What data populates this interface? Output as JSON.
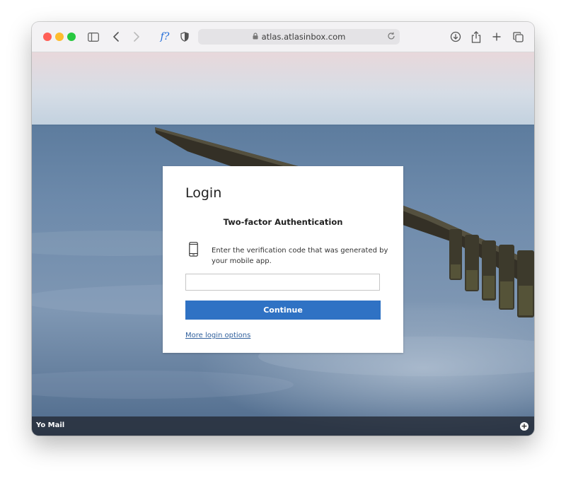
{
  "browser": {
    "address": "atlas.atlasinbox.com",
    "icons": {
      "close": "close-dot",
      "minimize": "minimize-dot",
      "zoom": "zoom-dot",
      "sidebar": "sidebar-icon",
      "back": "back-icon",
      "forward": "forward-icon",
      "extension": "f?",
      "shield": "shield-icon",
      "lock": "lock-icon",
      "reload": "reload-icon",
      "download": "download-icon",
      "share": "share-icon",
      "new_tab": "plus-icon",
      "tabs": "tabs-icon"
    },
    "colors": {
      "close": "#ff5f57",
      "minimize": "#febc2e",
      "zoom": "#28c840",
      "extension": "#1f6bd8"
    }
  },
  "login": {
    "title": "Login",
    "subtitle": "Two-factor Authentication",
    "instruction": "Enter the verification code that was generated by your mobile app.",
    "code_value": "",
    "code_placeholder": "",
    "continue_label": "Continue",
    "more_options": "More login options",
    "icon": "phone-icon",
    "accent": "#2f72c4"
  },
  "footer": {
    "label": "Yo Mail",
    "button_icon": "plus-circle-icon",
    "button_glyph": "+"
  }
}
